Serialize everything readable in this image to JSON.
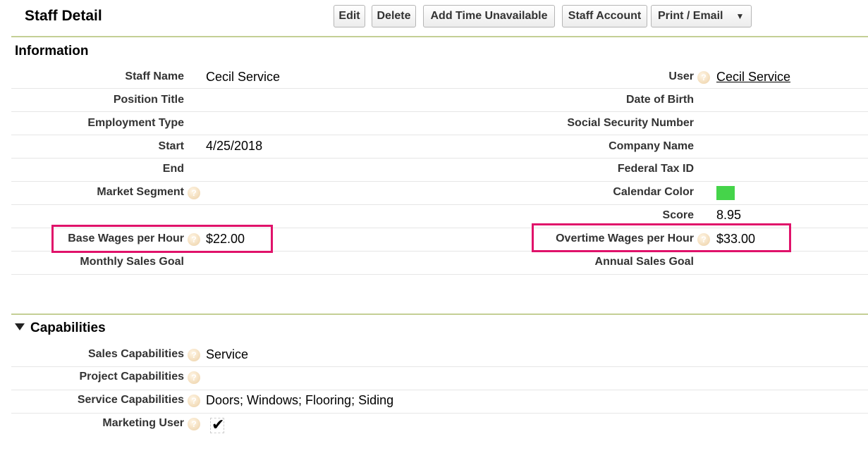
{
  "header": {
    "title": "Staff Detail",
    "buttons": {
      "edit": "Edit",
      "delete": "Delete",
      "add_time": "Add Time Unavailable",
      "staff_account": "Staff Account",
      "print_email": "Print / Email"
    }
  },
  "information": {
    "title": "Information",
    "left": [
      {
        "label": "Staff Name",
        "value": "Cecil Service"
      },
      {
        "label": "Position Title",
        "value": ""
      },
      {
        "label": "Employment Type",
        "value": ""
      },
      {
        "label": "Start",
        "value": "4/25/2018"
      },
      {
        "label": "End",
        "value": ""
      },
      {
        "label": "Market Segment",
        "value": ""
      },
      {
        "label": "",
        "value": ""
      },
      {
        "label": "Base Wages per Hour",
        "value": "$22.00"
      },
      {
        "label": "Monthly Sales Goal",
        "value": ""
      }
    ],
    "right": [
      {
        "label": "User",
        "value": "Cecil Service"
      },
      {
        "label": "Date of Birth",
        "value": ""
      },
      {
        "label": "Social Security Number",
        "value": ""
      },
      {
        "label": "Company Name",
        "value": ""
      },
      {
        "label": "Federal Tax ID",
        "value": ""
      },
      {
        "label": "Calendar Color",
        "value": ""
      },
      {
        "label": "Score",
        "value": "8.95"
      },
      {
        "label": "Overtime Wages per Hour",
        "value": "$33.00"
      },
      {
        "label": "Annual Sales Goal",
        "value": ""
      }
    ],
    "calendar_color": "#45d44a"
  },
  "capabilities": {
    "title": "Capabilities",
    "rows": [
      {
        "label": "Sales Capabilities",
        "value": "Service"
      },
      {
        "label": "Project Capabilities",
        "value": ""
      },
      {
        "label": "Service Capabilities",
        "value": "Doors; Windows; Flooring; Siding"
      },
      {
        "label": "Marketing User",
        "value": "",
        "checked": true
      }
    ]
  },
  "colors": {
    "highlight": "#e0126a",
    "rule": "#c4cf95"
  }
}
